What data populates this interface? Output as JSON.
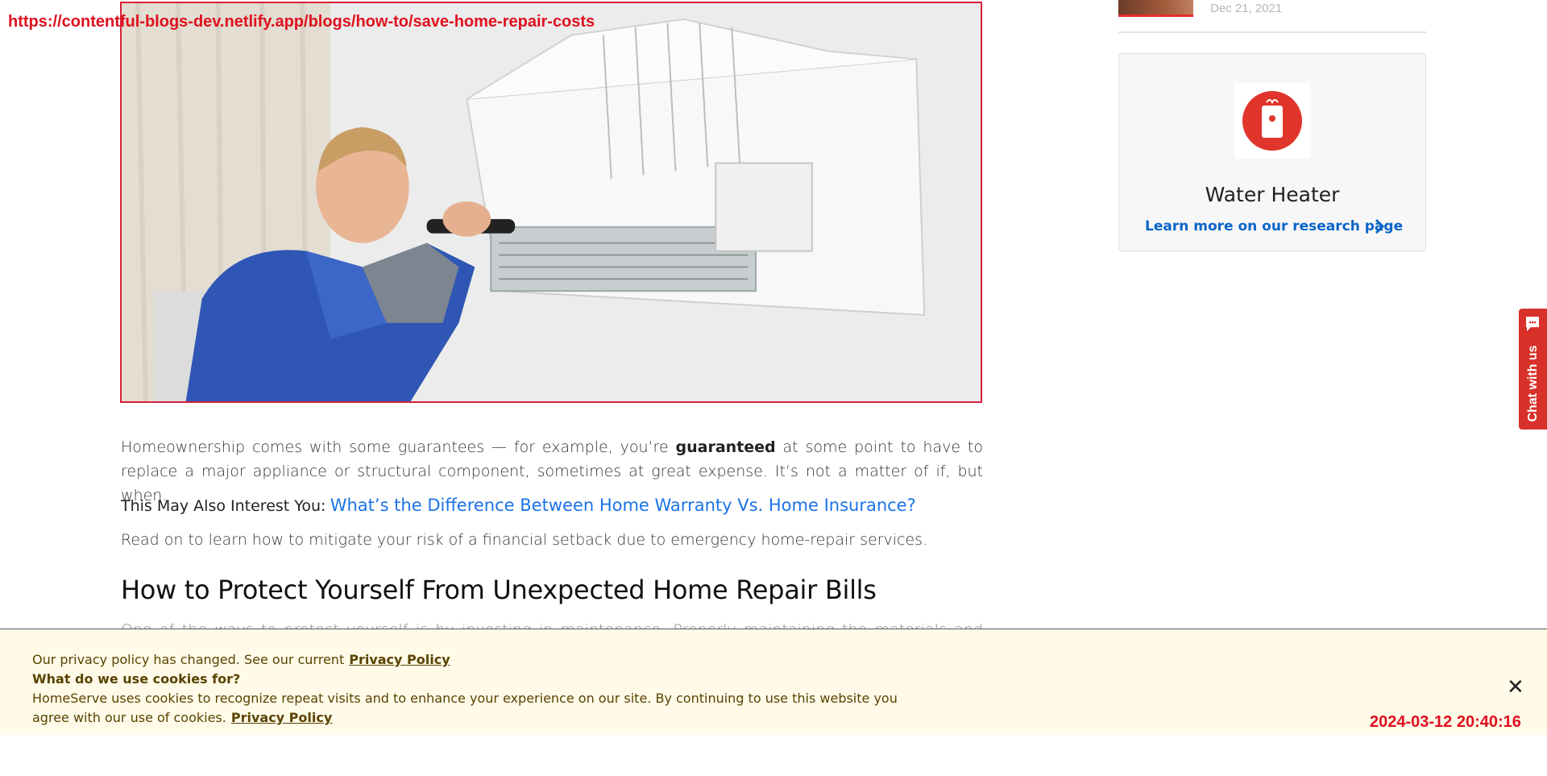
{
  "overlay": {
    "url": "https://contentful-blogs-dev.netlify.app/blogs/how-to/save-home-repair-costs",
    "timestamp": "2024-03-12 20:40:16"
  },
  "hero": {
    "alt": "Technician repairing a wall-mounted air conditioner"
  },
  "article": {
    "p1_before": "Homeownership comes with some guarantees — for example, you’re ",
    "p1_strong": "guaranteed",
    "p1_after": " at some point to have to replace a major appliance or structural component, sometimes at great expense. It’s not a matter of if, but when.",
    "interest_label": "This May Also Interest You:",
    "interest_link": "What’s the Difference Between Home Warranty Vs. Home Insurance?",
    "p2": "Read on to learn how to mitigate your risk of a financial setback due to emergency home-repair services.",
    "heading": "How to Protect Yourself From Unexpected Home Repair Bills",
    "p3": "One of the ways to protect yourself is by investing in maintenance. Properly maintaining the materials and systems in"
  },
  "sidebar": {
    "top_date": "Dec 21, 2021",
    "card": {
      "icon": "water-heater-icon",
      "title": "Water Heater",
      "link": "Learn more on our research page"
    }
  },
  "chat": {
    "label": "Chat with us"
  },
  "cookie": {
    "line1": "Our privacy policy has changed. See our current",
    "line1_link": "Privacy Policy",
    "question": "What do we use cookies for?",
    "line3": "HomeServe uses cookies to recognize repeat visits and to enhance your experience on our site. By continuing to use this website you",
    "line4": "agree with our use of cookies.",
    "line4_link": "Privacy Policy",
    "close": "✕"
  },
  "colors": {
    "brand_red": "#d8312a",
    "link_blue": "#1a73e8",
    "banner_bg": "#fffbe8"
  }
}
